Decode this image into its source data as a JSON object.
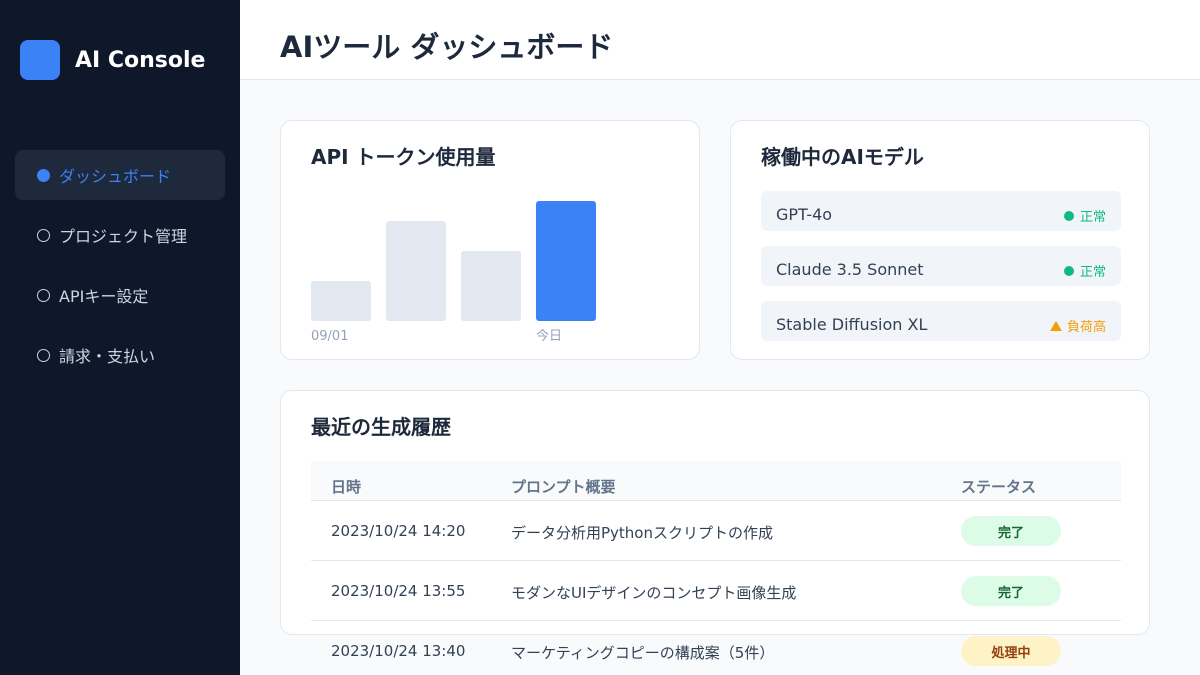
{
  "brand": {
    "name": "AI Console"
  },
  "sidebar": {
    "items": [
      {
        "label": "ダッシュボード",
        "active": true
      },
      {
        "label": "プロジェクト管理",
        "active": false
      },
      {
        "label": "APIキー設定",
        "active": false
      },
      {
        "label": "請求・支払い",
        "active": false
      }
    ]
  },
  "header": {
    "title": "AIツール ダッシュボード"
  },
  "usage": {
    "title": "API トークン使用量",
    "chart_data": {
      "type": "bar",
      "categories": [
        "09/01",
        "",
        "",
        "今日"
      ],
      "values": [
        40,
        100,
        70,
        120
      ],
      "highlight_index": 3,
      "colors": {
        "default": "#e2e8f0",
        "highlight": "#3b82f6",
        "label": "#94a3b8"
      }
    }
  },
  "models": {
    "title": "稼働中のAIモデル",
    "items": [
      {
        "name": "GPT-4o",
        "status": "正常",
        "kind": "ok",
        "color": "#10b981"
      },
      {
        "name": "Claude 3.5 Sonnet",
        "status": "正常",
        "kind": "ok",
        "color": "#10b981"
      },
      {
        "name": "Stable Diffusion XL",
        "status": "負荷高",
        "kind": "warn",
        "color": "#f59e0b"
      }
    ]
  },
  "history": {
    "title": "最近の生成履歴",
    "columns": [
      "日時",
      "プロンプト概要",
      "ステータス"
    ],
    "rows": [
      {
        "time": "2023/10/24 14:20",
        "prompt": "データ分析用Pythonスクリプトの作成",
        "status": "完了",
        "kind": "done"
      },
      {
        "time": "2023/10/24 13:55",
        "prompt": "モダンなUIデザインのコンセプト画像生成",
        "status": "完了",
        "kind": "done"
      },
      {
        "time": "2023/10/24 13:40",
        "prompt": "マーケティングコピーの構成案（5件）",
        "status": "処理中",
        "kind": "processing"
      }
    ],
    "badge_colors": {
      "done": {
        "bg": "#dcfce7",
        "fg": "#166534"
      },
      "processing": {
        "bg": "#fef3c7",
        "fg": "#92400e"
      }
    }
  }
}
